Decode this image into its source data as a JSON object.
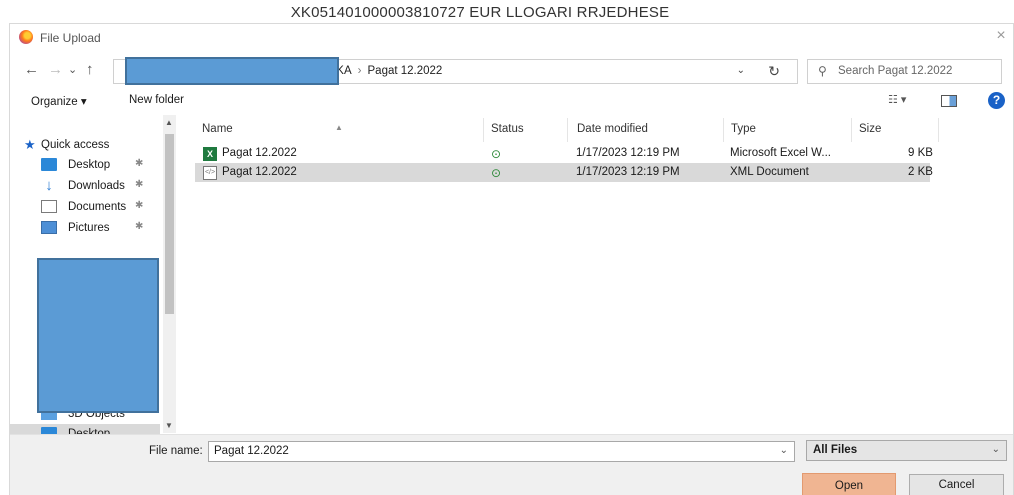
{
  "background_title": "XK051401000003810727 EUR LLOGARI RRJEDHESE",
  "window": {
    "title": "File Upload",
    "close": "×"
  },
  "navigation": {
    "back": "←",
    "forward": "→",
    "recent": "⌄",
    "up": "↑",
    "breadcrumb_partial": "NKA",
    "breadcrumb_separator": "›",
    "breadcrumb_current": "Pagat 12.2022",
    "refresh": "↻",
    "search_placeholder": "Search Pagat 12.2022"
  },
  "toolbar": {
    "organize": "Organize ▾",
    "new_folder": "New folder",
    "view": "☷ ▾",
    "help": "?"
  },
  "sidebar": {
    "quick_access": "Quick access",
    "items": [
      {
        "label": "Desktop",
        "icon": "desktop-icon",
        "pinned": true
      },
      {
        "label": "Downloads",
        "icon": "download-icon",
        "pinned": true
      },
      {
        "label": "Documents",
        "icon": "documents-icon",
        "pinned": true
      },
      {
        "label": "Pictures",
        "icon": "pictures-icon",
        "pinned": true
      }
    ],
    "partial_item": "3D Objects",
    "selected_item": "Desktop"
  },
  "columns": {
    "name": "Name",
    "status": "Status",
    "date_modified": "Date modified",
    "type": "Type",
    "size": "Size"
  },
  "files": [
    {
      "name": "Pagat 12.2022",
      "status": "⊙",
      "date": "1/17/2023 12:19 PM",
      "type": "Microsoft Excel W...",
      "size": "9 KB",
      "icon": "excel-file-icon"
    },
    {
      "name": "Pagat 12.2022",
      "status": "⊙",
      "date": "1/17/2023 12:19 PM",
      "type": "XML Document",
      "size": "2 KB",
      "icon": "xml-file-icon"
    }
  ],
  "footer": {
    "file_name_label": "File name:",
    "file_name_value": "Pagat 12.2022",
    "file_type": "All Files",
    "open": "Open",
    "cancel": "Cancel"
  },
  "colors": {
    "accent": "#1a62c7",
    "open_button": "#f0b592",
    "redaction": "#5b9bd5"
  }
}
